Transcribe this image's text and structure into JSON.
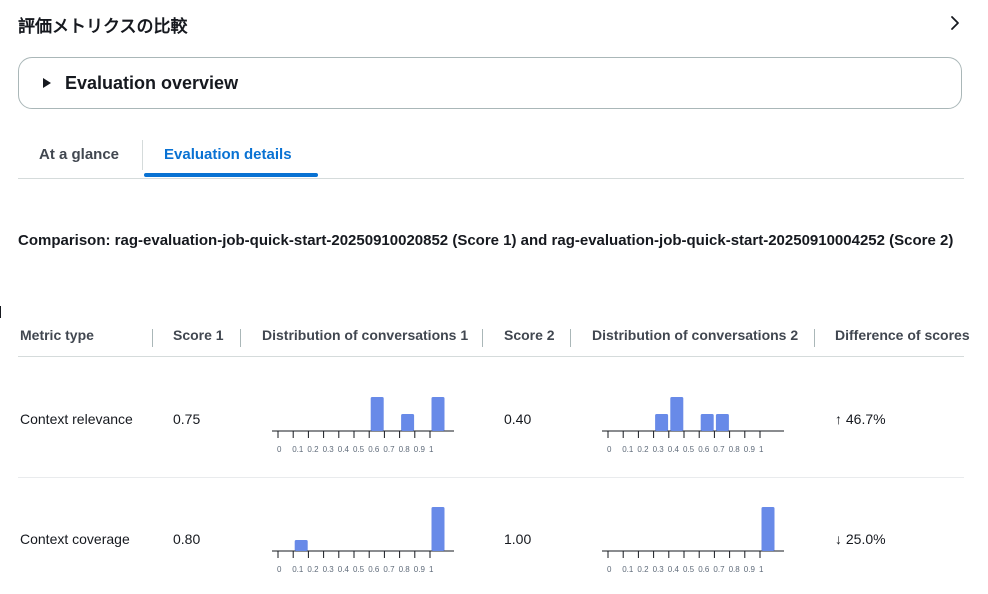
{
  "header": {
    "title": "評価メトリクスの比較"
  },
  "overview": {
    "title": "Evaluation overview"
  },
  "tabs": [
    {
      "label": "At a glance",
      "selected": false
    },
    {
      "label": "Evaluation details",
      "selected": true
    }
  ],
  "comparison_text": "Comparison: rag-evaluation-job-quick-start-20250910020852 (Score 1) and rag-evaluation-job-quick-start-20250910004252 (Score 2)",
  "table": {
    "columns": [
      "Metric type",
      "Score 1",
      "Distribution of conversations 1",
      "Score 2",
      "Distribution of conversations 2",
      "Difference of scores"
    ],
    "rows": [
      {
        "metric": "Context relevance",
        "score1": "0.75",
        "score2": "0.40",
        "difference": "↑ 46.7%"
      },
      {
        "metric": "Context coverage",
        "score1": "0.80",
        "score2": "1.00",
        "difference": "↓ 25.0%"
      }
    ]
  },
  "chart_data": [
    {
      "type": "bar",
      "name": "Context relevance — Distribution of conversations 1",
      "categories": [
        "0",
        "0.1",
        "0.2",
        "0.3",
        "0.4",
        "0.5",
        "0.6",
        "0.7",
        "0.8",
        "0.9",
        "1"
      ],
      "values": [
        0,
        0,
        0,
        0,
        0,
        0,
        2,
        0,
        1,
        0,
        2
      ],
      "xlabel": "",
      "ylabel": ""
    },
    {
      "type": "bar",
      "name": "Context relevance — Distribution of conversations 2",
      "categories": [
        "0",
        "0.1",
        "0.2",
        "0.3",
        "0.4",
        "0.5",
        "0.6",
        "0.7",
        "0.8",
        "0.9",
        "1"
      ],
      "values": [
        0,
        0,
        0,
        1,
        2,
        0,
        1,
        1,
        0,
        0,
        0
      ],
      "xlabel": "",
      "ylabel": ""
    },
    {
      "type": "bar",
      "name": "Context coverage — Distribution of conversations 1",
      "categories": [
        "0",
        "0.1",
        "0.2",
        "0.3",
        "0.4",
        "0.5",
        "0.6",
        "0.7",
        "0.8",
        "0.9",
        "1"
      ],
      "values": [
        0,
        1,
        0,
        0,
        0,
        0,
        0,
        0,
        0,
        0,
        4
      ],
      "xlabel": "",
      "ylabel": ""
    },
    {
      "type": "bar",
      "name": "Context coverage — Distribution of conversations 2",
      "categories": [
        "0",
        "0.1",
        "0.2",
        "0.3",
        "0.4",
        "0.5",
        "0.6",
        "0.7",
        "0.8",
        "0.9",
        "1"
      ],
      "values": [
        0,
        0,
        0,
        0,
        0,
        0,
        0,
        0,
        0,
        0,
        1
      ],
      "xlabel": "",
      "ylabel": ""
    }
  ],
  "colors": {
    "bar": "#688ae8",
    "link": "#0972d3"
  }
}
